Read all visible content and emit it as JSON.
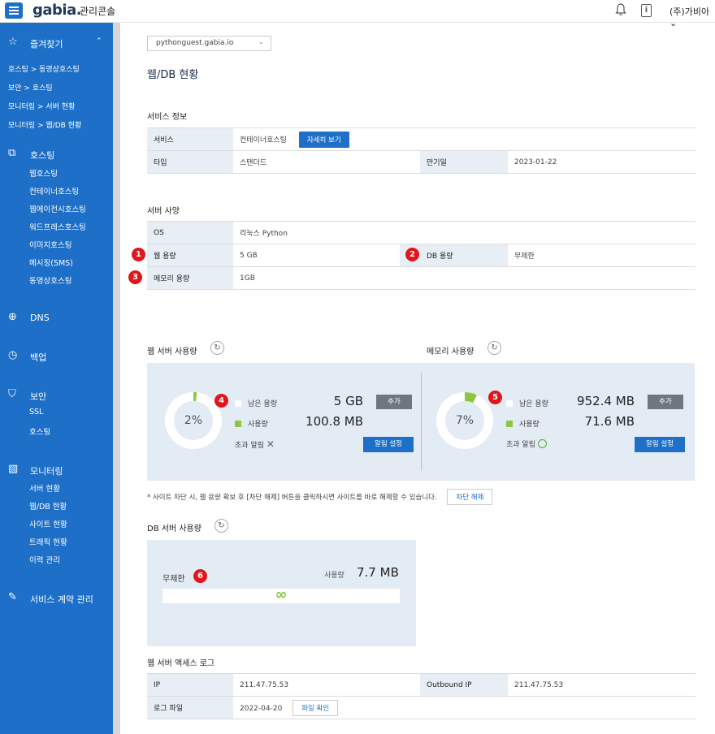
{
  "header": {
    "logo": "gabia.",
    "logo_sub": "관리콘솔",
    "user": "(주)가비아"
  },
  "sidebar": {
    "favorites_label": "즐겨찾기",
    "favorites": [
      "호스팅 > 동영상호스팅",
      "보안 > 호스팅",
      "모니터링 > 서버 현황",
      "모니터링 > 웹/DB 현황"
    ],
    "hosting_label": "호스팅",
    "hosting_items": [
      "웹호스팅",
      "컨테이너호스팅",
      "웹에이전시호스팅",
      "워드프레스호스팅",
      "이미지호스팅",
      "메시징(SMS)",
      "동영상호스팅"
    ],
    "dns_label": "DNS",
    "backup_label": "백업",
    "security_label": "보안",
    "security_items": [
      "SSL",
      "호스팅"
    ],
    "monitoring_label": "모니터링",
    "monitoring_items": [
      "서버 현황",
      "웹/DB 현황",
      "사이트 현황",
      "트래픽 현황",
      "이력 관리"
    ],
    "contract_label": "서비스 계약 관리"
  },
  "main": {
    "domain": "pythonguest.gabia.io",
    "page_title": "웹/DB 현황",
    "service_info": {
      "title": "서비스 정보",
      "service_label": "서비스",
      "service_value": "컨테이너호스팅",
      "detail_button": "자세히 보기",
      "type_label": "타입",
      "type_value": "스탠더드",
      "expire_label": "만기일",
      "expire_value": "2023-01-22"
    },
    "server_spec": {
      "title": "서버 사양",
      "os_label": "OS",
      "os_value": "리눅스 Python",
      "web_label": "웹 용량",
      "web_value": "5 GB",
      "db_label": "DB 용량",
      "db_value": "무제한",
      "mem_label": "메모리 용량",
      "mem_value": "1GB"
    },
    "markers": [
      "1",
      "2",
      "3",
      "4",
      "5",
      "6"
    ],
    "web_usage": {
      "title": "웹 서버 사용량",
      "percent_text": "2%",
      "percent": 2,
      "remain_label": "남은 용량",
      "remain_value": "5 GB",
      "used_label": "사용량",
      "used_value": "100.8 MB",
      "over_label": "초과 알림",
      "over_icon": "✕",
      "add_button": "추가",
      "alarm_button": "알림 설정"
    },
    "mem_usage": {
      "title": "메모리 사용량",
      "percent_text": "7%",
      "percent": 7,
      "remain_label": "남은 용량",
      "remain_value": "952.4 MB",
      "used_label": "사용량",
      "used_value": "71.6 MB",
      "over_label": "초과 알림",
      "add_button": "추가",
      "alarm_button": "알림 설정"
    },
    "note": "* 사이트 차단 시, 웹 용량 확보 후 [차단 해제] 버튼을 클릭하시면 사이트를 바로 해제할 수 있습니다.",
    "unblock_button": "차단 해제",
    "db_usage": {
      "title": "DB 서버 사용량",
      "limit_label": "무제한",
      "used_label": "사용량",
      "used_value": "7.7 MB",
      "infinity": "∞"
    },
    "access_log": {
      "title": "웹 서버 액세스 로그",
      "ip_label": "IP",
      "ip_value": "211.47.75.53",
      "outbound_label": "Outbound IP",
      "outbound_value": "211.47.75.53",
      "logfile_label": "로그 파일",
      "logfile_value": "2022-04-20",
      "file_button": "파일 확인"
    }
  },
  "colors": {
    "brand": "#1e6fc7",
    "used": "#8dc641",
    "marker": "#e0161b",
    "panel": "#e3ebf4"
  }
}
